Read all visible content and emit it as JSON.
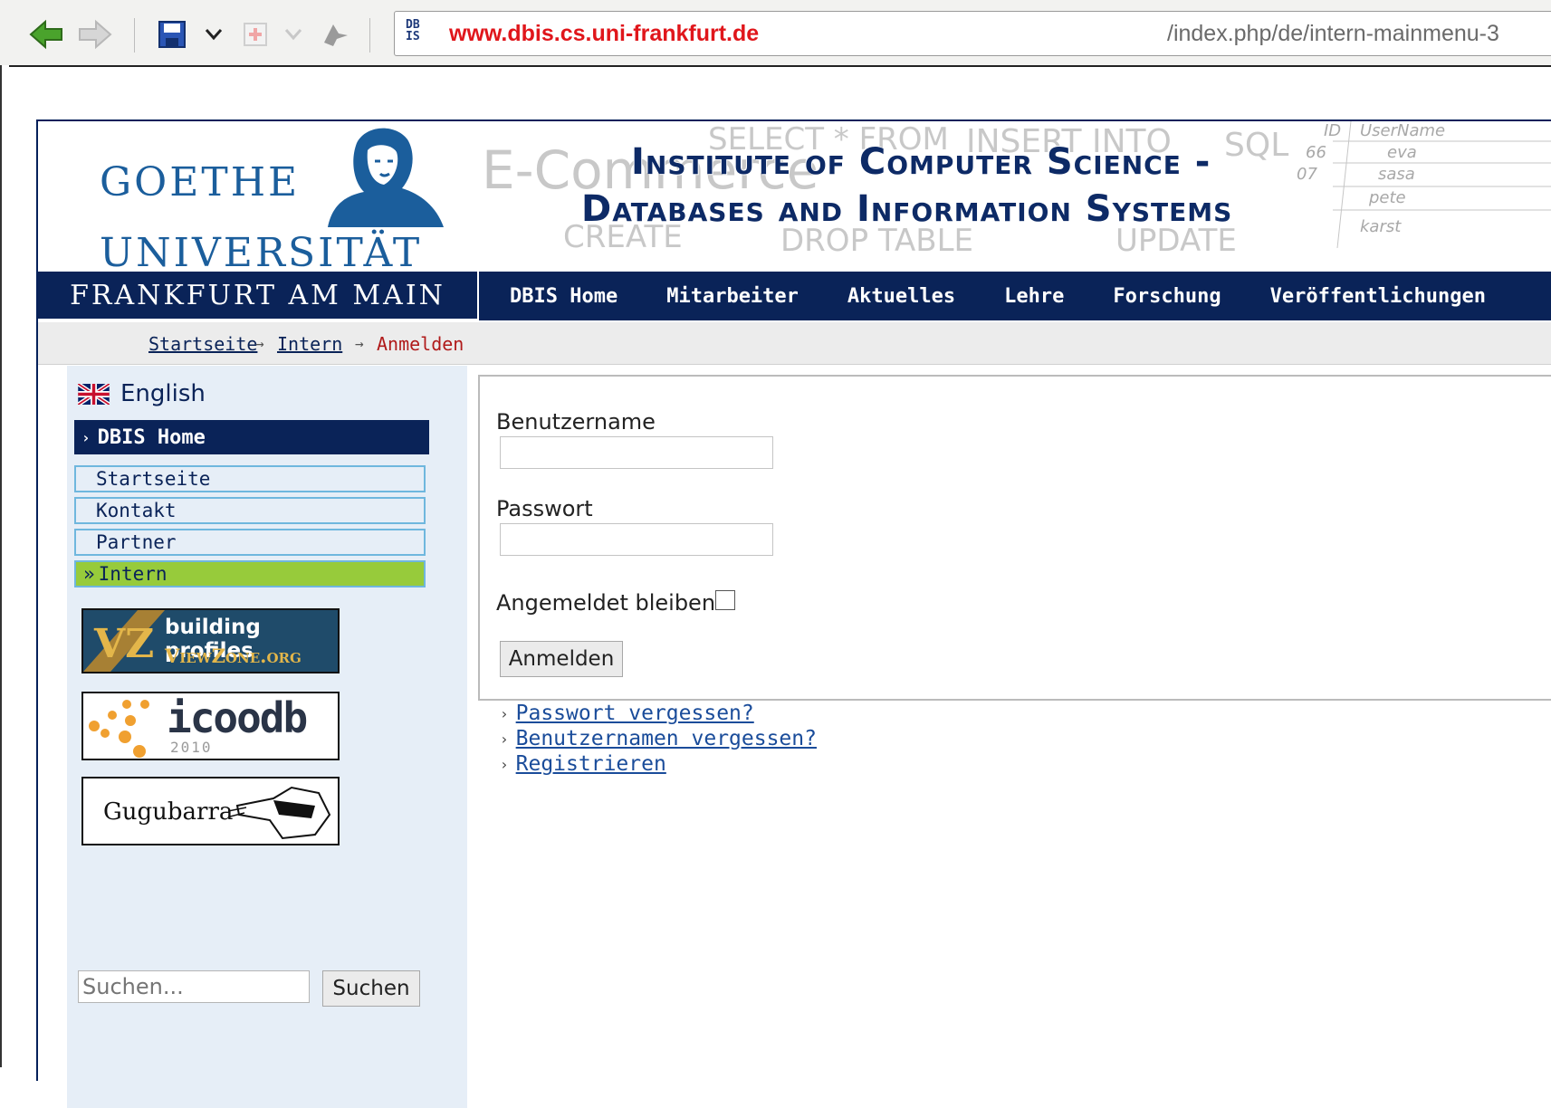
{
  "browser": {
    "url_host": "www.dbis.cs.uni-frankfurt.de",
    "url_path": "/index.php/de/intern-mainmenu-3",
    "favicon_text": [
      "DB",
      "IS"
    ],
    "icons": [
      "back-arrow-icon",
      "forward-arrow-icon",
      "save-icon",
      "dropdown-chevron-icon",
      "add-bookmark-icon",
      "dropdown-chevron-icon",
      "bird-icon"
    ]
  },
  "header": {
    "university_line1": "GOETHE",
    "university_line2": "UNIVERSITÄT",
    "university_line3": "FRANKFURT AM MAIN",
    "institute_line1": "Institute of Computer Science -",
    "institute_line2": "Databases and Information Systems",
    "background_words": [
      "E-Commerce",
      "SELECT * FROM",
      "INSERT INTO",
      "SQL",
      "CREATE",
      "DROP TABLE",
      "UPDATE"
    ],
    "user_table": {
      "headers": [
        "ID",
        "UserName"
      ],
      "rows": [
        [
          "66",
          "eva"
        ],
        [
          "07",
          "sasa"
        ],
        [
          "",
          "pete"
        ],
        [
          "",
          "karst"
        ]
      ]
    }
  },
  "nav": {
    "items": [
      "DBIS Home",
      "Mitarbeiter",
      "Aktuelles",
      "Lehre",
      "Forschung",
      "Veröffentlichungen"
    ]
  },
  "breadcrumb": {
    "items": [
      "Startseite",
      "Intern"
    ],
    "current": "Anmelden"
  },
  "sidebar": {
    "language": "English",
    "menu_title": "DBIS Home",
    "menu_items": [
      "Startseite",
      "Kontakt",
      "Partner",
      "Intern"
    ],
    "active_index": 3,
    "banners": [
      {
        "line1": "building profiles",
        "line2": "ViewZone.org"
      },
      {
        "line1": "icoodb",
        "line2": "2010"
      },
      {
        "line1": "Gugubarra"
      }
    ],
    "search_placeholder": "Suchen...",
    "search_button": "Suchen"
  },
  "login": {
    "username_label": "Benutzername",
    "password_label": "Passwort",
    "remember_label": "Angemeldet bleiben",
    "submit_label": "Anmelden",
    "links": [
      "Passwort vergessen?",
      "Benutzernamen vergessen?",
      "Registrieren"
    ]
  },
  "colors": {
    "navy": "#0a2358",
    "goethe_blue": "#1b5e9c",
    "active_green": "#97cb3b",
    "url_red": "#e0161b"
  }
}
